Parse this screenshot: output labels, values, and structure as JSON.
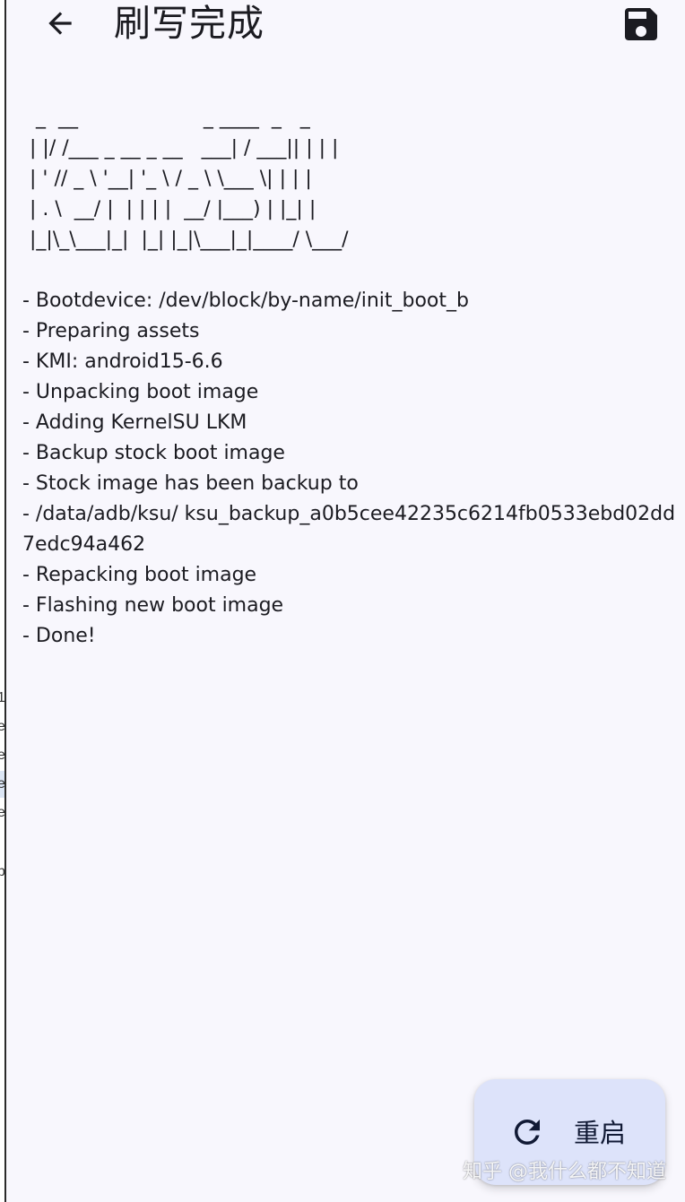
{
  "header": {
    "title": "刷写完成",
    "back_icon": "arrow-left-icon",
    "save_icon": "floppy-disk-icon"
  },
  "log": {
    "ascii_art": " _  __                    _ ____  _   _\n| |/ /___ _ __ _ __   ___| / ___|| | | |\n| ' // _ \\ '__| '_ \\ / _ \\ \\___ \\| | | |\n| . \\  __/ |  | | | |  __/ |___) | |_| |\n|_|\\_\\___|_|  |_| |_|\\___|_|____/ \\___/",
    "lines": [
      "- Bootdevice: /dev/block/by-name/init_boot_b",
      "- Preparing assets",
      "- KMI: android15-6.6",
      "- Unpacking boot image",
      "- Adding KernelSU LKM",
      "- Backup stock boot image",
      "- Stock image has been backup to",
      "- /data/adb/ksu/ ksu_backup_a0b5cee42235c6214fb0533ebd02dd7edc94a462",
      "- Repacking boot image",
      "- Flashing new boot image",
      "- Done!"
    ]
  },
  "fab": {
    "label": "重启",
    "icon": "refresh-icon"
  },
  "watermark": {
    "text": "知乎 @我什么都不知道"
  },
  "left_strip": {
    "fragments": [
      "1",
      "e",
      "e",
      "e",
      "e",
      "p"
    ]
  },
  "colors": {
    "background": "#f8f7fd",
    "fab_background": "#dde3fa",
    "icon": "#1b1b21",
    "fab_icon": "#111a35"
  }
}
